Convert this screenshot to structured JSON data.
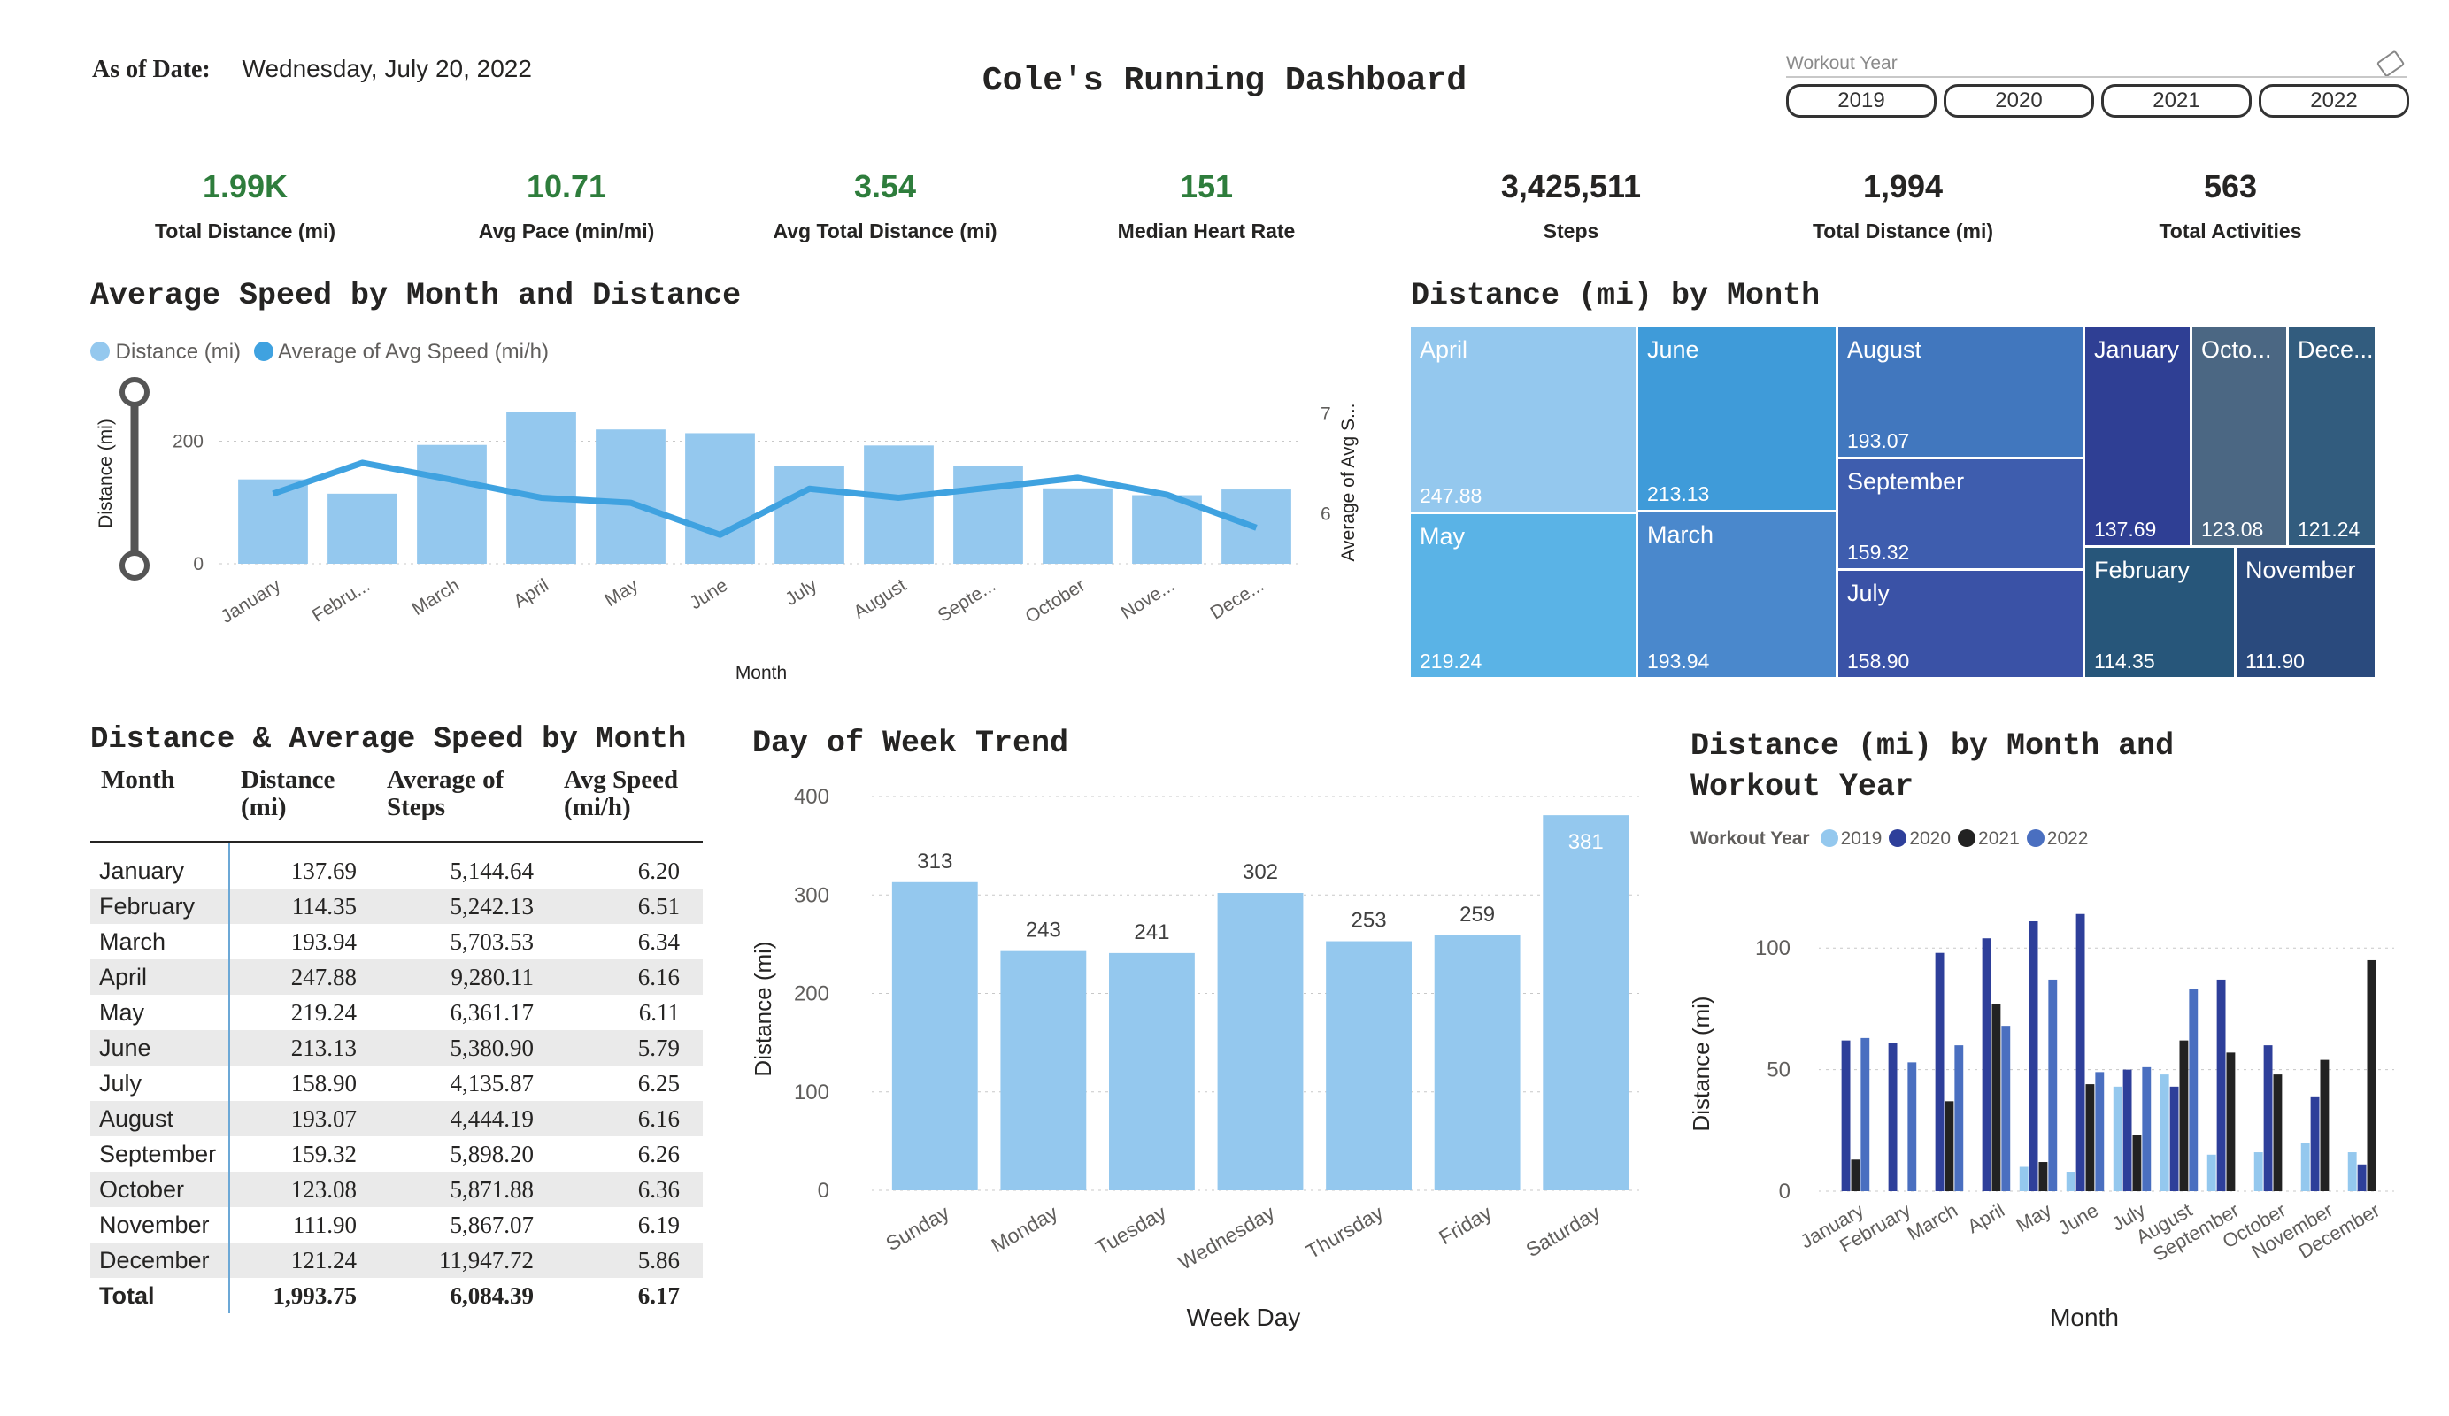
{
  "header": {
    "as_of_label": "As of Date:",
    "as_of_value": "Wednesday, July 20, 2022",
    "title": "Cole's Running Dashboard"
  },
  "slicer": {
    "title": "Workout Year",
    "options": [
      "2019",
      "2020",
      "2021",
      "2022"
    ]
  },
  "kpis": [
    {
      "value": "1.99K",
      "label": "Total Distance (mi)",
      "color": "#2e7d3c"
    },
    {
      "value": "10.71",
      "label": "Avg Pace (min/mi)",
      "color": "#2e7d3c"
    },
    {
      "value": "3.54",
      "label": "Avg Total Distance (mi)",
      "color": "#2e7d3c"
    },
    {
      "value": "151",
      "label": "Median Heart Rate",
      "color": "#2e7d3c"
    },
    {
      "value": "3,425,511",
      "label": "Steps",
      "color": "#252423"
    },
    {
      "value": "1,994",
      "label": "Total Distance (mi)",
      "color": "#252423"
    },
    {
      "value": "563",
      "label": "Total Activities",
      "color": "#252423"
    }
  ],
  "colors": {
    "bar_light": "#94c8ee",
    "line_blue": "#3fa2e0",
    "year_2019": "#94c8ee",
    "year_2020": "#2e3f9a",
    "year_2021": "#222222",
    "year_2022": "#4a6fc0"
  },
  "speed_chart": {
    "title": "Average Speed by Month and Distance",
    "legend": [
      "Distance (mi)",
      "Average of Avg Speed (mi/h)"
    ],
    "xlabel": "Month",
    "ylabel_left": "Distance (mi)",
    "ylabel_right": "Average of Avg S...",
    "left_ticks": [
      "0",
      "200"
    ],
    "right_ticks": [
      "6",
      "7"
    ],
    "x_tick_labels": [
      "January",
      "Febru...",
      "March",
      "April",
      "May",
      "June",
      "July",
      "August",
      "Septe...",
      "October",
      "Nove...",
      "Dece..."
    ]
  },
  "treemap": {
    "title": "Distance (mi) by Month",
    "tiles": [
      {
        "name": "April",
        "value": "247.88",
        "color": "#94c8ee"
      },
      {
        "name": "May",
        "value": "219.24",
        "color": "#5ab3e6"
      },
      {
        "name": "June",
        "value": "213.13",
        "color": "#3f9bd9"
      },
      {
        "name": "March",
        "value": "193.94",
        "color": "#4a88cc"
      },
      {
        "name": "August",
        "value": "193.07",
        "color": "#4177be"
      },
      {
        "name": "September",
        "value": "159.32",
        "color": "#3e5dae"
      },
      {
        "name": "July",
        "value": "158.90",
        "color": "#3a52a6"
      },
      {
        "name": "January",
        "value": "137.69",
        "color": "#2f3f94"
      },
      {
        "name": "Octo...",
        "value": "123.08",
        "color": "#4b6783"
      },
      {
        "name": "Dece...",
        "value": "121.24",
        "color": "#325c7e"
      },
      {
        "name": "February",
        "value": "114.35",
        "color": "#27567a"
      },
      {
        "name": "November",
        "value": "111.90",
        "color": "#2a4a7d"
      }
    ]
  },
  "table": {
    "title": "Distance & Average Speed by Month",
    "headers": [
      "Month",
      "Distance (mi)",
      "Average of Steps",
      "Avg Speed (mi/h)"
    ],
    "rows": [
      [
        "January",
        "137.69",
        "5,144.64",
        "6.20"
      ],
      [
        "February",
        "114.35",
        "5,242.13",
        "6.51"
      ],
      [
        "March",
        "193.94",
        "5,703.53",
        "6.34"
      ],
      [
        "April",
        "247.88",
        "9,280.11",
        "6.16"
      ],
      [
        "May",
        "219.24",
        "6,361.17",
        "6.11"
      ],
      [
        "June",
        "213.13",
        "5,380.90",
        "5.79"
      ],
      [
        "July",
        "158.90",
        "4,135.87",
        "6.25"
      ],
      [
        "August",
        "193.07",
        "4,444.19",
        "6.16"
      ],
      [
        "September",
        "159.32",
        "5,898.20",
        "6.26"
      ],
      [
        "October",
        "123.08",
        "5,871.88",
        "6.36"
      ],
      [
        "November",
        "111.90",
        "5,867.07",
        "6.19"
      ],
      [
        "December",
        "121.24",
        "11,947.72",
        "5.86"
      ]
    ],
    "total": [
      "Total",
      "1,993.75",
      "6,084.39",
      "6.17"
    ]
  },
  "dow_chart": {
    "title": "Day of Week Trend",
    "xlabel": "Week Day",
    "ylabel": "Distance (mi)",
    "ticks": [
      "0",
      "100",
      "200",
      "300",
      "400"
    ]
  },
  "year_chart": {
    "title_line1": "Distance (mi) by Month and",
    "title_line2": "Workout Year",
    "legend_title": "Workout Year",
    "xlabel": "Month",
    "ylabel": "Distance (mi)",
    "ticks": [
      "0",
      "50",
      "100"
    ]
  },
  "chart_data": [
    {
      "type": "bar",
      "title": "Average Speed by Month and Distance",
      "categories": [
        "January",
        "February",
        "March",
        "April",
        "May",
        "June",
        "July",
        "August",
        "September",
        "October",
        "November",
        "December"
      ],
      "series": [
        {
          "name": "Distance (mi)",
          "type": "bar",
          "axis": "left",
          "values": [
            137.69,
            114.35,
            193.94,
            247.88,
            219.24,
            213.13,
            158.9,
            193.07,
            159.32,
            123.08,
            111.9,
            121.24
          ]
        },
        {
          "name": "Average of Avg Speed (mi/h)",
          "type": "line",
          "axis": "right",
          "values": [
            6.2,
            6.51,
            6.34,
            6.16,
            6.11,
            5.79,
            6.25,
            6.16,
            6.26,
            6.36,
            6.19,
            5.86
          ]
        }
      ],
      "xlabel": "Month",
      "ylabel": "Distance (mi)",
      "ylim": [
        0,
        260
      ],
      "y2lim": [
        5.5,
        7.2
      ]
    },
    {
      "type": "bar",
      "title": "Day of Week Trend",
      "categories": [
        "Sunday",
        "Monday",
        "Tuesday",
        "Wednesday",
        "Thursday",
        "Friday",
        "Saturday"
      ],
      "values": [
        313,
        243,
        241,
        302,
        253,
        259,
        381
      ],
      "xlabel": "Week Day",
      "ylabel": "Distance (mi)",
      "ylim": [
        0,
        400
      ]
    },
    {
      "type": "bar",
      "title": "Distance (mi) by Month and Workout Year",
      "categories": [
        "January",
        "February",
        "March",
        "April",
        "May",
        "June",
        "July",
        "August",
        "September",
        "October",
        "November",
        "December"
      ],
      "series": [
        {
          "name": "2019",
          "values": [
            0,
            0,
            0,
            0,
            10,
            8,
            43,
            48,
            15,
            16,
            20,
            16
          ]
        },
        {
          "name": "2020",
          "values": [
            62,
            61,
            98,
            104,
            111,
            114,
            50,
            43,
            87,
            60,
            39,
            11
          ]
        },
        {
          "name": "2021",
          "values": [
            13,
            0,
            37,
            77,
            12,
            44,
            23,
            62,
            57,
            48,
            54,
            95
          ]
        },
        {
          "name": "2022",
          "values": [
            63,
            53,
            60,
            68,
            87,
            49,
            51,
            83,
            0,
            0,
            0,
            0
          ]
        }
      ],
      "xlabel": "Month",
      "ylabel": "Distance (mi)",
      "ylim": [
        0,
        115
      ]
    }
  ]
}
